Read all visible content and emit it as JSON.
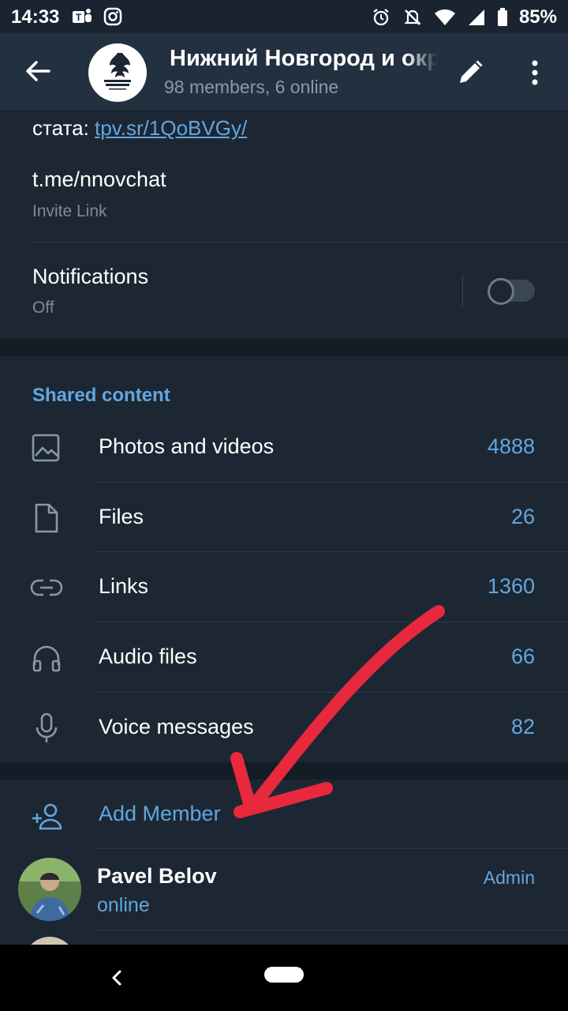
{
  "status_bar": {
    "time": "14:33",
    "battery": "85%",
    "icons": [
      "teams-icon",
      "instagram-icon",
      "alarm-icon",
      "mute-icon",
      "wifi-icon",
      "signal-icon",
      "battery-icon"
    ]
  },
  "header": {
    "title": "Нижний Новгород и округа",
    "subtitle": "98 members, 6 online"
  },
  "info": {
    "description_prefix": "стата: ",
    "description_link": "tpv.sr/1QoBVGy/",
    "invite_link": "t.me/nnovchat",
    "invite_link_caption": "Invite Link",
    "notifications_label": "Notifications",
    "notifications_value": "Off",
    "notifications_enabled": false
  },
  "shared_content": {
    "heading": "Shared content",
    "items": [
      {
        "label": "Photos and videos",
        "count": "4888",
        "icon": "photo-icon"
      },
      {
        "label": "Files",
        "count": "26",
        "icon": "file-icon"
      },
      {
        "label": "Links",
        "count": "1360",
        "icon": "link-icon"
      },
      {
        "label": "Audio files",
        "count": "66",
        "icon": "headphones-icon"
      },
      {
        "label": "Voice messages",
        "count": "82",
        "icon": "microphone-icon"
      }
    ]
  },
  "members": {
    "add_label": "Add Member",
    "list": [
      {
        "name": "Pavel Belov",
        "status": "online",
        "role": "Admin"
      }
    ]
  },
  "colors": {
    "background": "#1d2733",
    "header": "#233040",
    "accent": "#62a6e0",
    "annotation_arrow": "#e8283c"
  }
}
